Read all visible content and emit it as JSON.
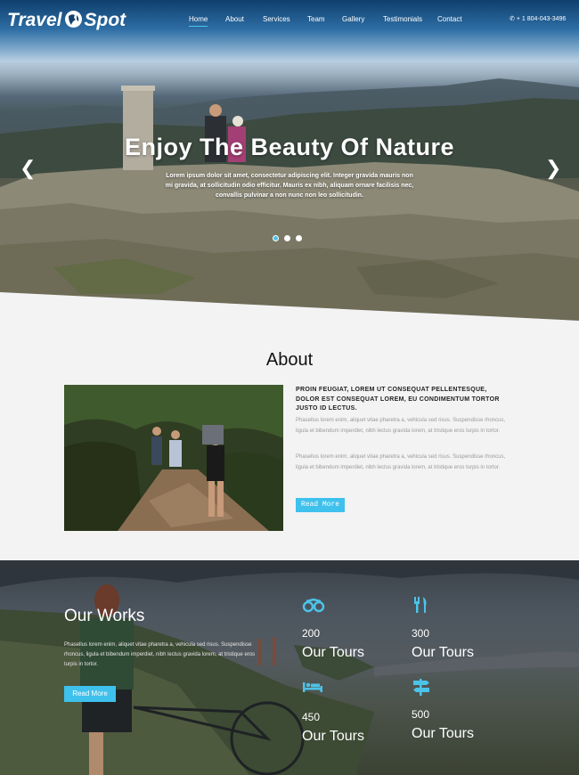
{
  "header": {
    "logo_left": "Travel",
    "logo_right": "Spot",
    "nav": [
      "Home",
      "About",
      "Services",
      "Team",
      "Gallery",
      "Testimonials",
      "Contact"
    ],
    "active": "Home",
    "phone": "+ 1 804-043-3496"
  },
  "hero": {
    "title": "Enjoy The Beauty Of Nature",
    "text": "Lorem ipsum dolor sit amet, consectetur adipiscing elit. Integer gravida mauris non mi gravida, at sollicitudin odio efficitur. Mauris ex nibh, aliquam ornare facilisis nec, convallis pulvinar a non nunc non leo sollicitudin.",
    "prev_icon": "chevron-left-icon",
    "next_icon": "chevron-right-icon",
    "slides": 3,
    "active_slide": 1
  },
  "about": {
    "title": "About",
    "lead": "PROIN FEUGIAT, LOREM UT CONSEQUAT PELLENTESQUE, DOLOR EST CONSEQUAT LOREM, EU CONDIMENTUM TORTOR JUSTO ID LECTUS.",
    "p1": "Phasellus lorem enim, aliquet vitae pharetra a, vehicula sed risus. Suspendisse rhoncus, ligula et bibendum imperdiet, nibh lectus gravida lorem, at tristique eros turpis in tortor.",
    "p2": "Phasellus lorem enim, aliquet vitae pharetra a, vehicula sed risus. Suspendisse rhoncus, ligula et bibendum imperdiet, nibh lectus gravida lorem, at tristique eros turpis in tortor.",
    "button": "Read More"
  },
  "works": {
    "title": "Our Works",
    "text": "Phasellus lorem enim, aliquet vitae pharetra a, vehicula sed risus. Suspendisse rhoncus, ligula et bibendum imperdiet, nibh lectus gravida lorem, at tristique eros turpis in tortor.",
    "button": "Read More",
    "stats": [
      {
        "icon": "binoculars-icon",
        "value": "200",
        "label": "Our Tours"
      },
      {
        "icon": "cutlery-icon",
        "value": "300",
        "label": "Our Tours"
      },
      {
        "icon": "bed-icon",
        "value": "450",
        "label": "Our Tours"
      },
      {
        "icon": "signpost-icon",
        "value": "500",
        "label": "Our Tours"
      }
    ]
  },
  "colors": {
    "accent": "#3ec1ec",
    "dark_band": "#4d565f",
    "page_bg": "#f3f3f4"
  }
}
